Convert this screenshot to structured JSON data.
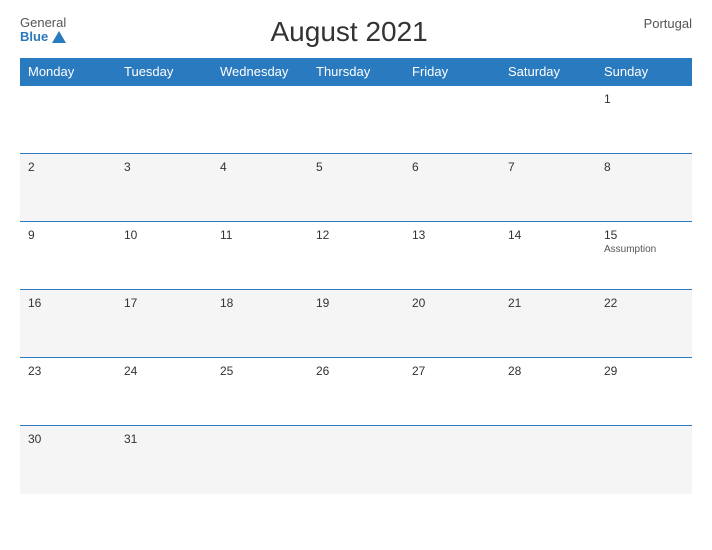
{
  "header": {
    "logo_general": "General",
    "logo_blue": "Blue",
    "title": "August 2021",
    "country": "Portugal"
  },
  "weekdays": [
    "Monday",
    "Tuesday",
    "Wednesday",
    "Thursday",
    "Friday",
    "Saturday",
    "Sunday"
  ],
  "weeks": [
    [
      {
        "day": "",
        "event": ""
      },
      {
        "day": "",
        "event": ""
      },
      {
        "day": "",
        "event": ""
      },
      {
        "day": "",
        "event": ""
      },
      {
        "day": "",
        "event": ""
      },
      {
        "day": "",
        "event": ""
      },
      {
        "day": "1",
        "event": ""
      }
    ],
    [
      {
        "day": "2",
        "event": ""
      },
      {
        "day": "3",
        "event": ""
      },
      {
        "day": "4",
        "event": ""
      },
      {
        "day": "5",
        "event": ""
      },
      {
        "day": "6",
        "event": ""
      },
      {
        "day": "7",
        "event": ""
      },
      {
        "day": "8",
        "event": ""
      }
    ],
    [
      {
        "day": "9",
        "event": ""
      },
      {
        "day": "10",
        "event": ""
      },
      {
        "day": "11",
        "event": ""
      },
      {
        "day": "12",
        "event": ""
      },
      {
        "day": "13",
        "event": ""
      },
      {
        "day": "14",
        "event": ""
      },
      {
        "day": "15",
        "event": "Assumption"
      }
    ],
    [
      {
        "day": "16",
        "event": ""
      },
      {
        "day": "17",
        "event": ""
      },
      {
        "day": "18",
        "event": ""
      },
      {
        "day": "19",
        "event": ""
      },
      {
        "day": "20",
        "event": ""
      },
      {
        "day": "21",
        "event": ""
      },
      {
        "day": "22",
        "event": ""
      }
    ],
    [
      {
        "day": "23",
        "event": ""
      },
      {
        "day": "24",
        "event": ""
      },
      {
        "day": "25",
        "event": ""
      },
      {
        "day": "26",
        "event": ""
      },
      {
        "day": "27",
        "event": ""
      },
      {
        "day": "28",
        "event": ""
      },
      {
        "day": "29",
        "event": ""
      }
    ],
    [
      {
        "day": "30",
        "event": ""
      },
      {
        "day": "31",
        "event": ""
      },
      {
        "day": "",
        "event": ""
      },
      {
        "day": "",
        "event": ""
      },
      {
        "day": "",
        "event": ""
      },
      {
        "day": "",
        "event": ""
      },
      {
        "day": "",
        "event": ""
      }
    ]
  ]
}
